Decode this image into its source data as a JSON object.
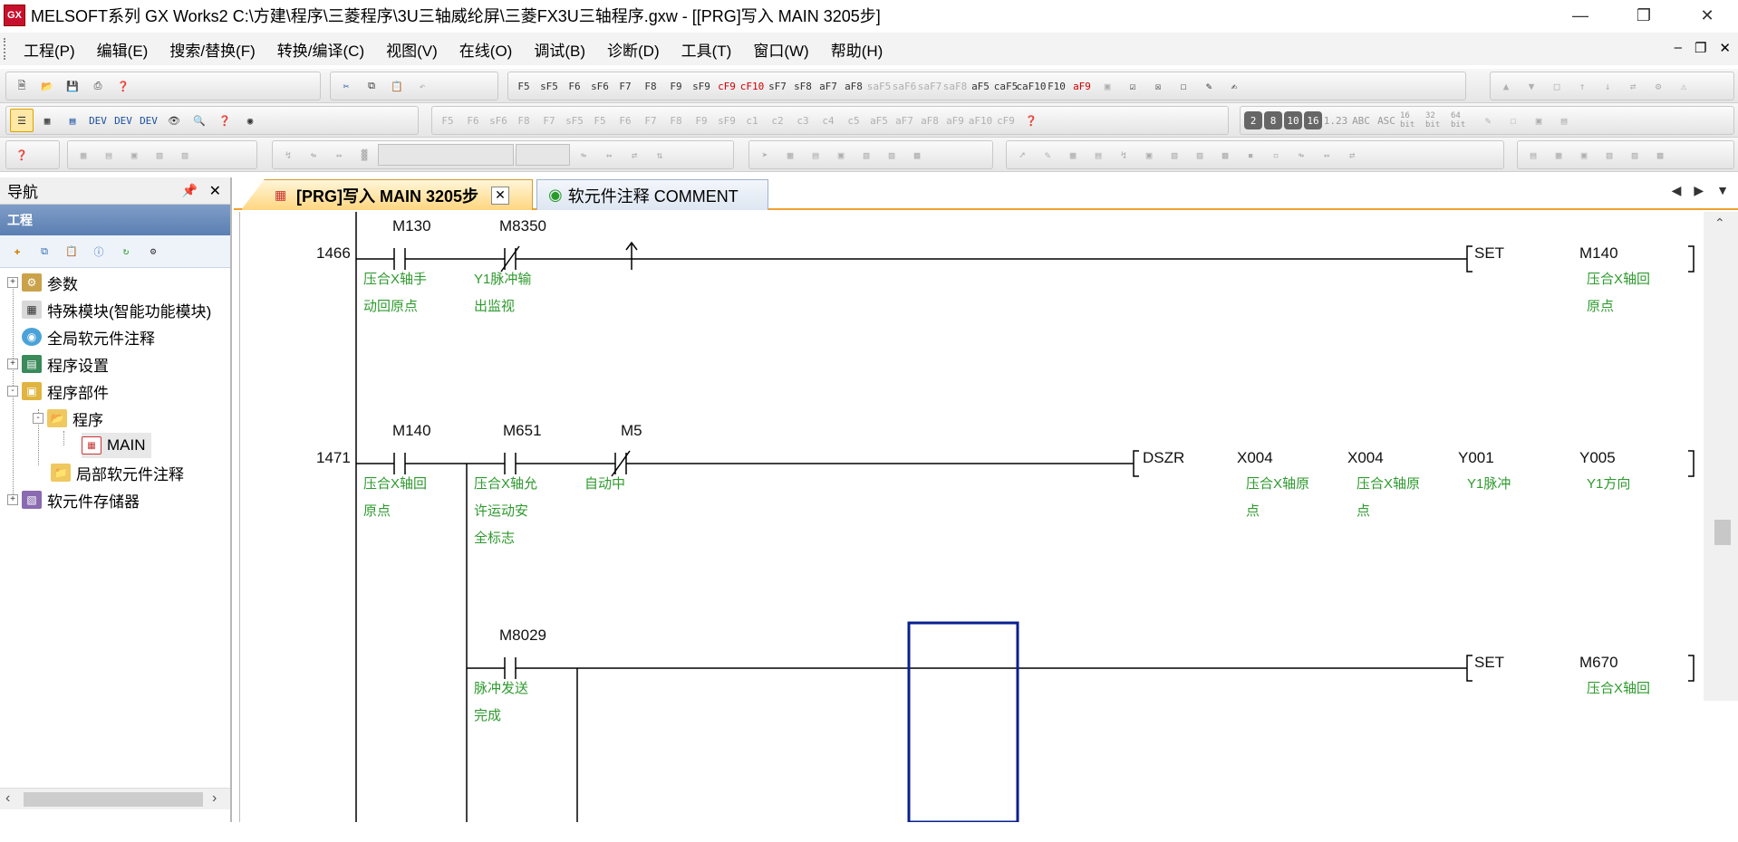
{
  "window": {
    "title": "MELSOFT系列 GX Works2 C:\\方建\\程序\\三菱程序\\3U三轴威纶屏\\三菱FX3U三轴程序.gxw - [[PRG]写入 MAIN 3205步]",
    "app_icon_text": "GX"
  },
  "menu": {
    "items": [
      "工程(P)",
      "编辑(E)",
      "搜索/替换(F)",
      "转换/编译(C)",
      "视图(V)",
      "在线(O)",
      "调试(B)",
      "诊断(D)",
      "工具(T)",
      "窗口(W)",
      "帮助(H)"
    ]
  },
  "toolbar": {
    "row2_ladder_keys": [
      "F5",
      "sF5",
      "F6",
      "sF6",
      "F7",
      "F8",
      "F9",
      "sF9",
      "cF9",
      "cF10",
      "sF7",
      "sF8",
      "aF7",
      "aF8",
      "saF5",
      "saF6",
      "saF7",
      "saF8",
      "aF5",
      "caF5",
      "caF10",
      "F10",
      "aF9"
    ],
    "row3_keys": [
      "F5",
      "F6",
      "sF6",
      "F8",
      "F7",
      "sF5",
      "F5",
      "F6",
      "F7",
      "F8",
      "F9",
      "sF9",
      "c1",
      "c2",
      "c3",
      "c4",
      "c5",
      "aF5",
      "aF7",
      "aF8",
      "aF9",
      "aF10",
      "cF9"
    ],
    "row3_format": [
      "2",
      "8",
      "10",
      "16",
      "1.23",
      "ABC",
      "ASC",
      "16 bit",
      "32 bit",
      "64 bit"
    ]
  },
  "navigation": {
    "title": "导航",
    "section": "工程",
    "tree": [
      {
        "label": "参数",
        "level": 0,
        "toggle": "+"
      },
      {
        "label": "特殊模块(智能功能模块)",
        "level": 0,
        "toggle": ""
      },
      {
        "label": "全局软元件注释",
        "level": 0,
        "toggle": ""
      },
      {
        "label": "程序设置",
        "level": 0,
        "toggle": "+"
      },
      {
        "label": "程序部件",
        "level": 0,
        "toggle": "-"
      },
      {
        "label": "程序",
        "level": 1,
        "toggle": "-"
      },
      {
        "label": "MAIN",
        "level": 2,
        "toggle": ""
      },
      {
        "label": "局部软元件注释",
        "level": 1,
        "toggle": ""
      },
      {
        "label": "软元件存储器",
        "level": 0,
        "toggle": "+"
      }
    ]
  },
  "tabs": [
    {
      "label": "[PRG]写入 MAIN 3205步",
      "active": true
    },
    {
      "label": "软元件注释 COMMENT",
      "active": false
    }
  ],
  "ladder": {
    "rungs": [
      {
        "step": "1466",
        "contacts": [
          {
            "device": "M130",
            "type": "NO",
            "comment": [
              "压合X轴手",
              "动回原点"
            ]
          },
          {
            "device": "M8350",
            "type": "NC",
            "comment": [
              "Y1脉冲输",
              "出监视"
            ]
          }
        ],
        "instruction": "SET",
        "operands": [
          {
            "device": "M140",
            "comment": [
              "压合X轴回",
              "原点"
            ]
          }
        ]
      },
      {
        "step": "1471",
        "contacts": [
          {
            "device": "M140",
            "type": "NO",
            "comment": [
              "压合X轴回",
              "原点"
            ]
          },
          {
            "device": "M651",
            "type": "NO",
            "comment": [
              "压合X轴允",
              "许运动安",
              "全标志"
            ]
          },
          {
            "device": "M5",
            "type": "NC",
            "comment": [
              "自动中"
            ]
          }
        ],
        "instruction": "DSZR",
        "operands": [
          {
            "device": "X004",
            "comment": [
              "压合X轴原",
              "点"
            ]
          },
          {
            "device": "X004",
            "comment": [
              "压合X轴原",
              "点"
            ]
          },
          {
            "device": "Y001",
            "comment": [
              "Y1脉冲"
            ]
          },
          {
            "device": "Y005",
            "comment": [
              "Y1方向"
            ]
          }
        ]
      },
      {
        "step": "",
        "contacts": [
          {
            "device": "M8029",
            "type": "NO",
            "comment": [
              "脉冲发送",
              "完成"
            ]
          }
        ],
        "instruction": "SET",
        "operands": [
          {
            "device": "M670",
            "comment": [
              "压合X轴回"
            ]
          }
        ]
      }
    ]
  }
}
